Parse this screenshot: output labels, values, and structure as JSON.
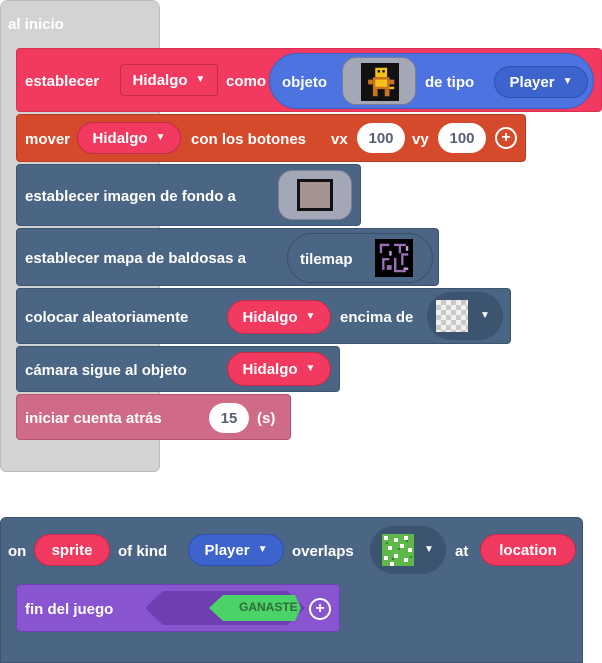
{
  "on_start": {
    "label": "al inicio",
    "blocks": {
      "set_sprite": {
        "set": "establecer",
        "variable": "Hidalgo",
        "as": "como",
        "object": "objeto",
        "of_kind": "de tipo",
        "kind": "Player"
      },
      "move": {
        "label": "mover",
        "variable": "Hidalgo",
        "with_buttons": "con los botones",
        "vx_label": "vx",
        "vx": "100",
        "vy_label": "vy",
        "vy": "100"
      },
      "background": {
        "label": "establecer imagen de fondo a"
      },
      "tilemap": {
        "label": "establecer mapa de baldosas a",
        "value": "tilemap"
      },
      "place": {
        "label": "colocar aleatoriamente",
        "variable": "Hidalgo",
        "on_top_of": "encima de"
      },
      "camera": {
        "label": "cámara sigue al objeto",
        "variable": "Hidalgo"
      },
      "countdown": {
        "label": "iniciar cuenta atrás",
        "value": "15",
        "unit": "(s)"
      }
    }
  },
  "overlap": {
    "on": "on",
    "sprite": "sprite",
    "of_kind": "of kind",
    "kind": "Player",
    "overlaps": "overlaps",
    "at": "at",
    "location": "location",
    "game_over": {
      "label": "fin del juego",
      "result": "GANASTE"
    }
  },
  "colors": {
    "sprites": "#f2395f",
    "controller": "#d64a2c",
    "scene": "#4b6584",
    "info": "#cf6a87",
    "game": "#8854d0",
    "sprite_kind": "#4c73e0"
  }
}
